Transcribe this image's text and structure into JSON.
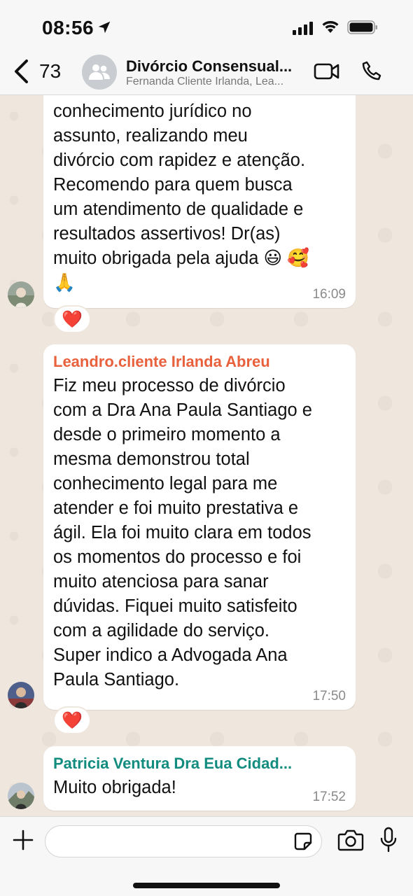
{
  "status_bar": {
    "time": "08:56"
  },
  "header": {
    "back_count": "73",
    "title": "Divórcio Consensual...",
    "subtitle": "Fernanda Cliente Irlanda, Lea..."
  },
  "messages": [
    {
      "text": "conhecimento jurídico no\nassunto, realizando meu\ndivórcio com rapidez e atenção.\nRecomendo para quem busca\num atendimento de qualidade e\nresultados assertivos! Dr(as)\nmuito obrigada pela ajuda 😃 🥰\n🙏",
      "time": "16:09",
      "reaction": "❤️"
    },
    {
      "sender": "Leandro.cliente Irlanda Abreu",
      "sender_color": "#e8603c",
      "text": "Fiz meu processo de divórcio\ncom a Dra Ana Paula Santiago e\ndesde o primeiro momento a\nmesma demonstrou total\nconhecimento legal para me\natender e foi muito prestativa e\nágil. Ela foi muito clara em todos\nos momentos do processo e foi\nmuito atenciosa para sanar\ndúvidas. Fiquei muito satisfeito\ncom a agilidade do serviço.\nSuper indico a Advogada Ana\nPaula Santiago.",
      "time": "17:50",
      "reaction": "❤️"
    },
    {
      "sender": "Patricia Ventura Dra Eua Cidad...",
      "sender_color": "#128c7e",
      "text": "Muito obrigada!",
      "time": "17:52"
    }
  ],
  "input": {
    "placeholder": ""
  }
}
